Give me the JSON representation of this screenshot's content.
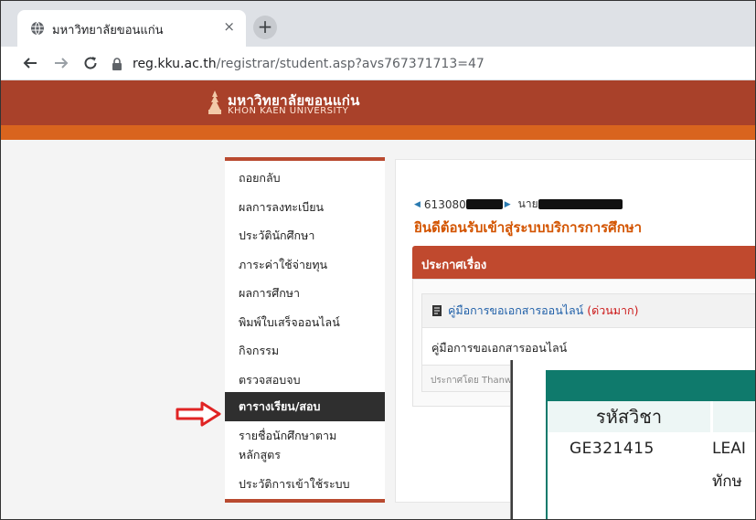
{
  "browser": {
    "tab_title": "มหาวิทยาลัยขอนแก่น",
    "tab_close": "×",
    "new_tab": "+",
    "url_host": "reg.kku.ac.th",
    "url_path": "/registrar/student.asp?avs767371713=47"
  },
  "header": {
    "university_th": "มหาวิทยาลัยขอนแก่น",
    "university_en": "KHON KAEN UNIVERSITY",
    "colors": {
      "header": "#a9412a",
      "stripe": "#d9641e"
    }
  },
  "sidebar": {
    "items": [
      {
        "label": "ถอยกลับ"
      },
      {
        "label": "ผลการลงทะเบียน"
      },
      {
        "label": "ประวัตินักศึกษา"
      },
      {
        "label": "ภาระค่าใช้จ่ายทุน"
      },
      {
        "label": "ผลการศึกษา"
      },
      {
        "label": "พิมพ์ใบเสร็จออนไลน์"
      },
      {
        "label": "กิจกรรม"
      },
      {
        "label": "ตรวจสอบจบ"
      },
      {
        "label": "ตารางเรียน/สอบ",
        "active": true
      },
      {
        "label": "รายชื่อนักศึกษาตามหลักสูตร"
      },
      {
        "label": "ประวัติการเข้าใช้ระบบ"
      }
    ]
  },
  "main": {
    "student_id_prefix": "613080",
    "student_name_prefix": "นาย",
    "welcome": "ยินดีต้อนรับเข้าสู่ระบบบริการการศึกษา",
    "announce_header": "ประกาศเรื่อง",
    "announcement": {
      "title": "คู่มือการขอเอกสารออนไลน์",
      "urgency": "(ด่วนมาก)",
      "body": "คู่มือการขอเอกสารออนไลน์",
      "meta": "ประกาศโดย  Thanw"
    }
  },
  "overlay": {
    "column_header": "รหัสวิชา",
    "course_code": "GE321415",
    "course_name_line1": "LEAI",
    "course_name_line2": "ทักษ"
  }
}
